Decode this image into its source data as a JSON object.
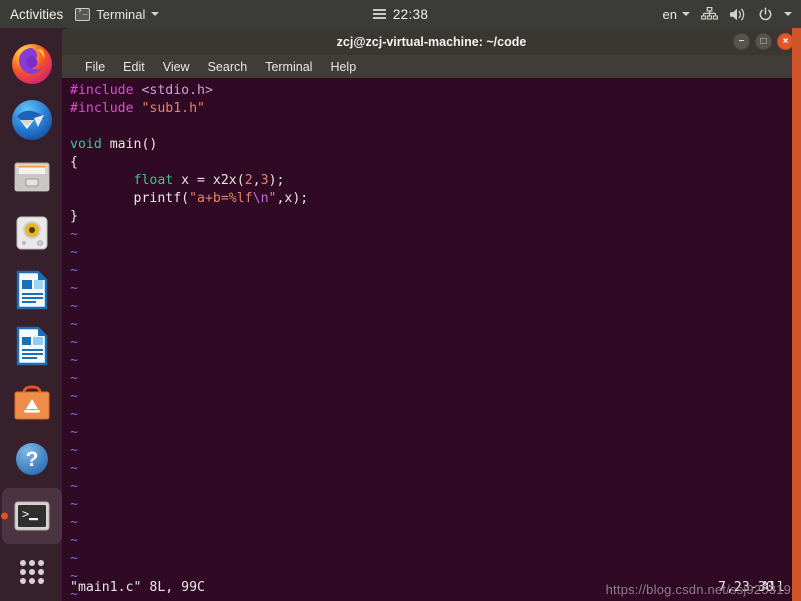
{
  "topbar": {
    "activities": "Activities",
    "app_menu": {
      "label": "Terminal",
      "icon": "terminal-icon"
    },
    "clock": "22:38",
    "clock_icon": "calendar-menu-icon",
    "language": "en",
    "indicators": [
      "network-wired-icon",
      "volume-icon",
      "power-icon",
      "chevron-down-icon"
    ],
    "bg": "#3b3b37"
  },
  "dock": {
    "bg": "#36202c",
    "active_indicator_color": "#e8521f",
    "items": [
      {
        "name": "firefox",
        "label": "Firefox Web Browser",
        "active": false
      },
      {
        "name": "thunderbird",
        "label": "Thunderbird Mail",
        "active": false
      },
      {
        "name": "files",
        "label": "Files",
        "active": false
      },
      {
        "name": "rhythmbox",
        "label": "Rhythmbox",
        "active": false
      },
      {
        "name": "libreoffice-impress",
        "label": "LibreOffice Impress",
        "active": false
      },
      {
        "name": "libreoffice-writer",
        "label": "LibreOffice Writer",
        "active": false
      },
      {
        "name": "ubuntu-software",
        "label": "Ubuntu Software",
        "active": false
      },
      {
        "name": "help",
        "label": "Help",
        "active": false
      },
      {
        "name": "terminal",
        "label": "Terminal",
        "active": true
      },
      {
        "name": "show-applications",
        "label": "Show Applications",
        "active": false
      }
    ]
  },
  "window": {
    "title": "zcj@zcj-virtual-machine: ~/code",
    "buttons": {
      "minimize": "−",
      "maximize": "□",
      "close": "×"
    },
    "menus": [
      "File",
      "Edit",
      "View",
      "Search",
      "Terminal",
      "Help"
    ],
    "bg": "#300a24"
  },
  "editor": {
    "file": "main1.c",
    "lines": [
      [
        {
          "t": "#include ",
          "c": "c-pre"
        },
        {
          "t": "<stdio.h>",
          "c": "c-hdr"
        }
      ],
      [
        {
          "t": "#include ",
          "c": "c-pre"
        },
        {
          "t": "\"sub1.h\"",
          "c": "c-str"
        }
      ],
      [],
      [
        {
          "t": "void ",
          "c": "c-type"
        },
        {
          "t": "main()",
          "c": "c-fn"
        }
      ],
      [
        {
          "t": "{",
          "c": "c-brc"
        }
      ],
      [
        {
          "t": "        ",
          "c": "c-fn"
        },
        {
          "t": "float",
          "c": "c-type"
        },
        {
          "t": " x = x2x(",
          "c": "c-fn"
        },
        {
          "t": "2",
          "c": "c-num"
        },
        {
          "t": ",",
          "c": "c-fn"
        },
        {
          "t": "3",
          "c": "c-num"
        },
        {
          "t": ");",
          "c": "c-fn"
        }
      ],
      [
        {
          "t": "        printf(",
          "c": "c-fn"
        },
        {
          "t": "\"a+b=%lf",
          "c": "c-str"
        },
        {
          "t": "\\n",
          "c": "c-esc"
        },
        {
          "t": "\"",
          "c": "c-str"
        },
        {
          "t": ",x);",
          "c": "c-fn"
        }
      ],
      [
        {
          "t": "}",
          "c": "c-brc"
        }
      ]
    ],
    "tilde": "~",
    "tilde_count": 21,
    "status": {
      "file_info": "\"main1.c\" 8L, 99C",
      "position": "7,23-30",
      "scroll": "All"
    }
  },
  "watermark": "https://blog.csdn.net/ssj925319"
}
